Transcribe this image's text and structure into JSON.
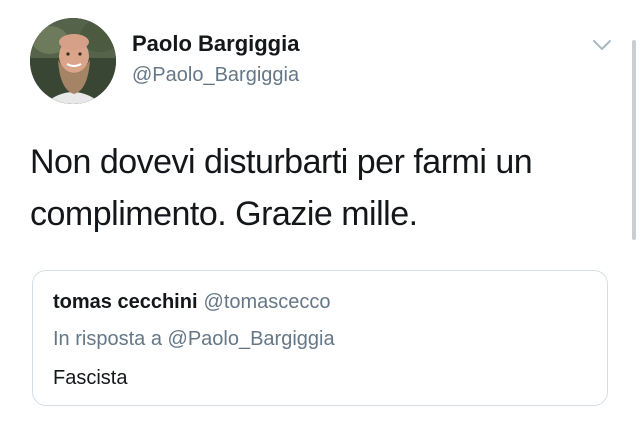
{
  "tweet": {
    "author": {
      "display_name": "Paolo Bargiggia",
      "handle": "@Paolo_Bargiggia"
    },
    "text": "Non dovevi disturbarti per farmi un\ncomplimento. Grazie mille.",
    "menu_icon": "chevron-down-icon"
  },
  "quoted_tweet": {
    "display_name": "tomas cecchini",
    "handle": "@tomascecco",
    "reply_prefix": "In risposta a",
    "reply_to": "@Paolo_Bargiggia",
    "text": "Fascista"
  },
  "colors": {
    "primary_text": "#14171a",
    "secondary_text": "#657786",
    "border": "#d6dee4"
  }
}
